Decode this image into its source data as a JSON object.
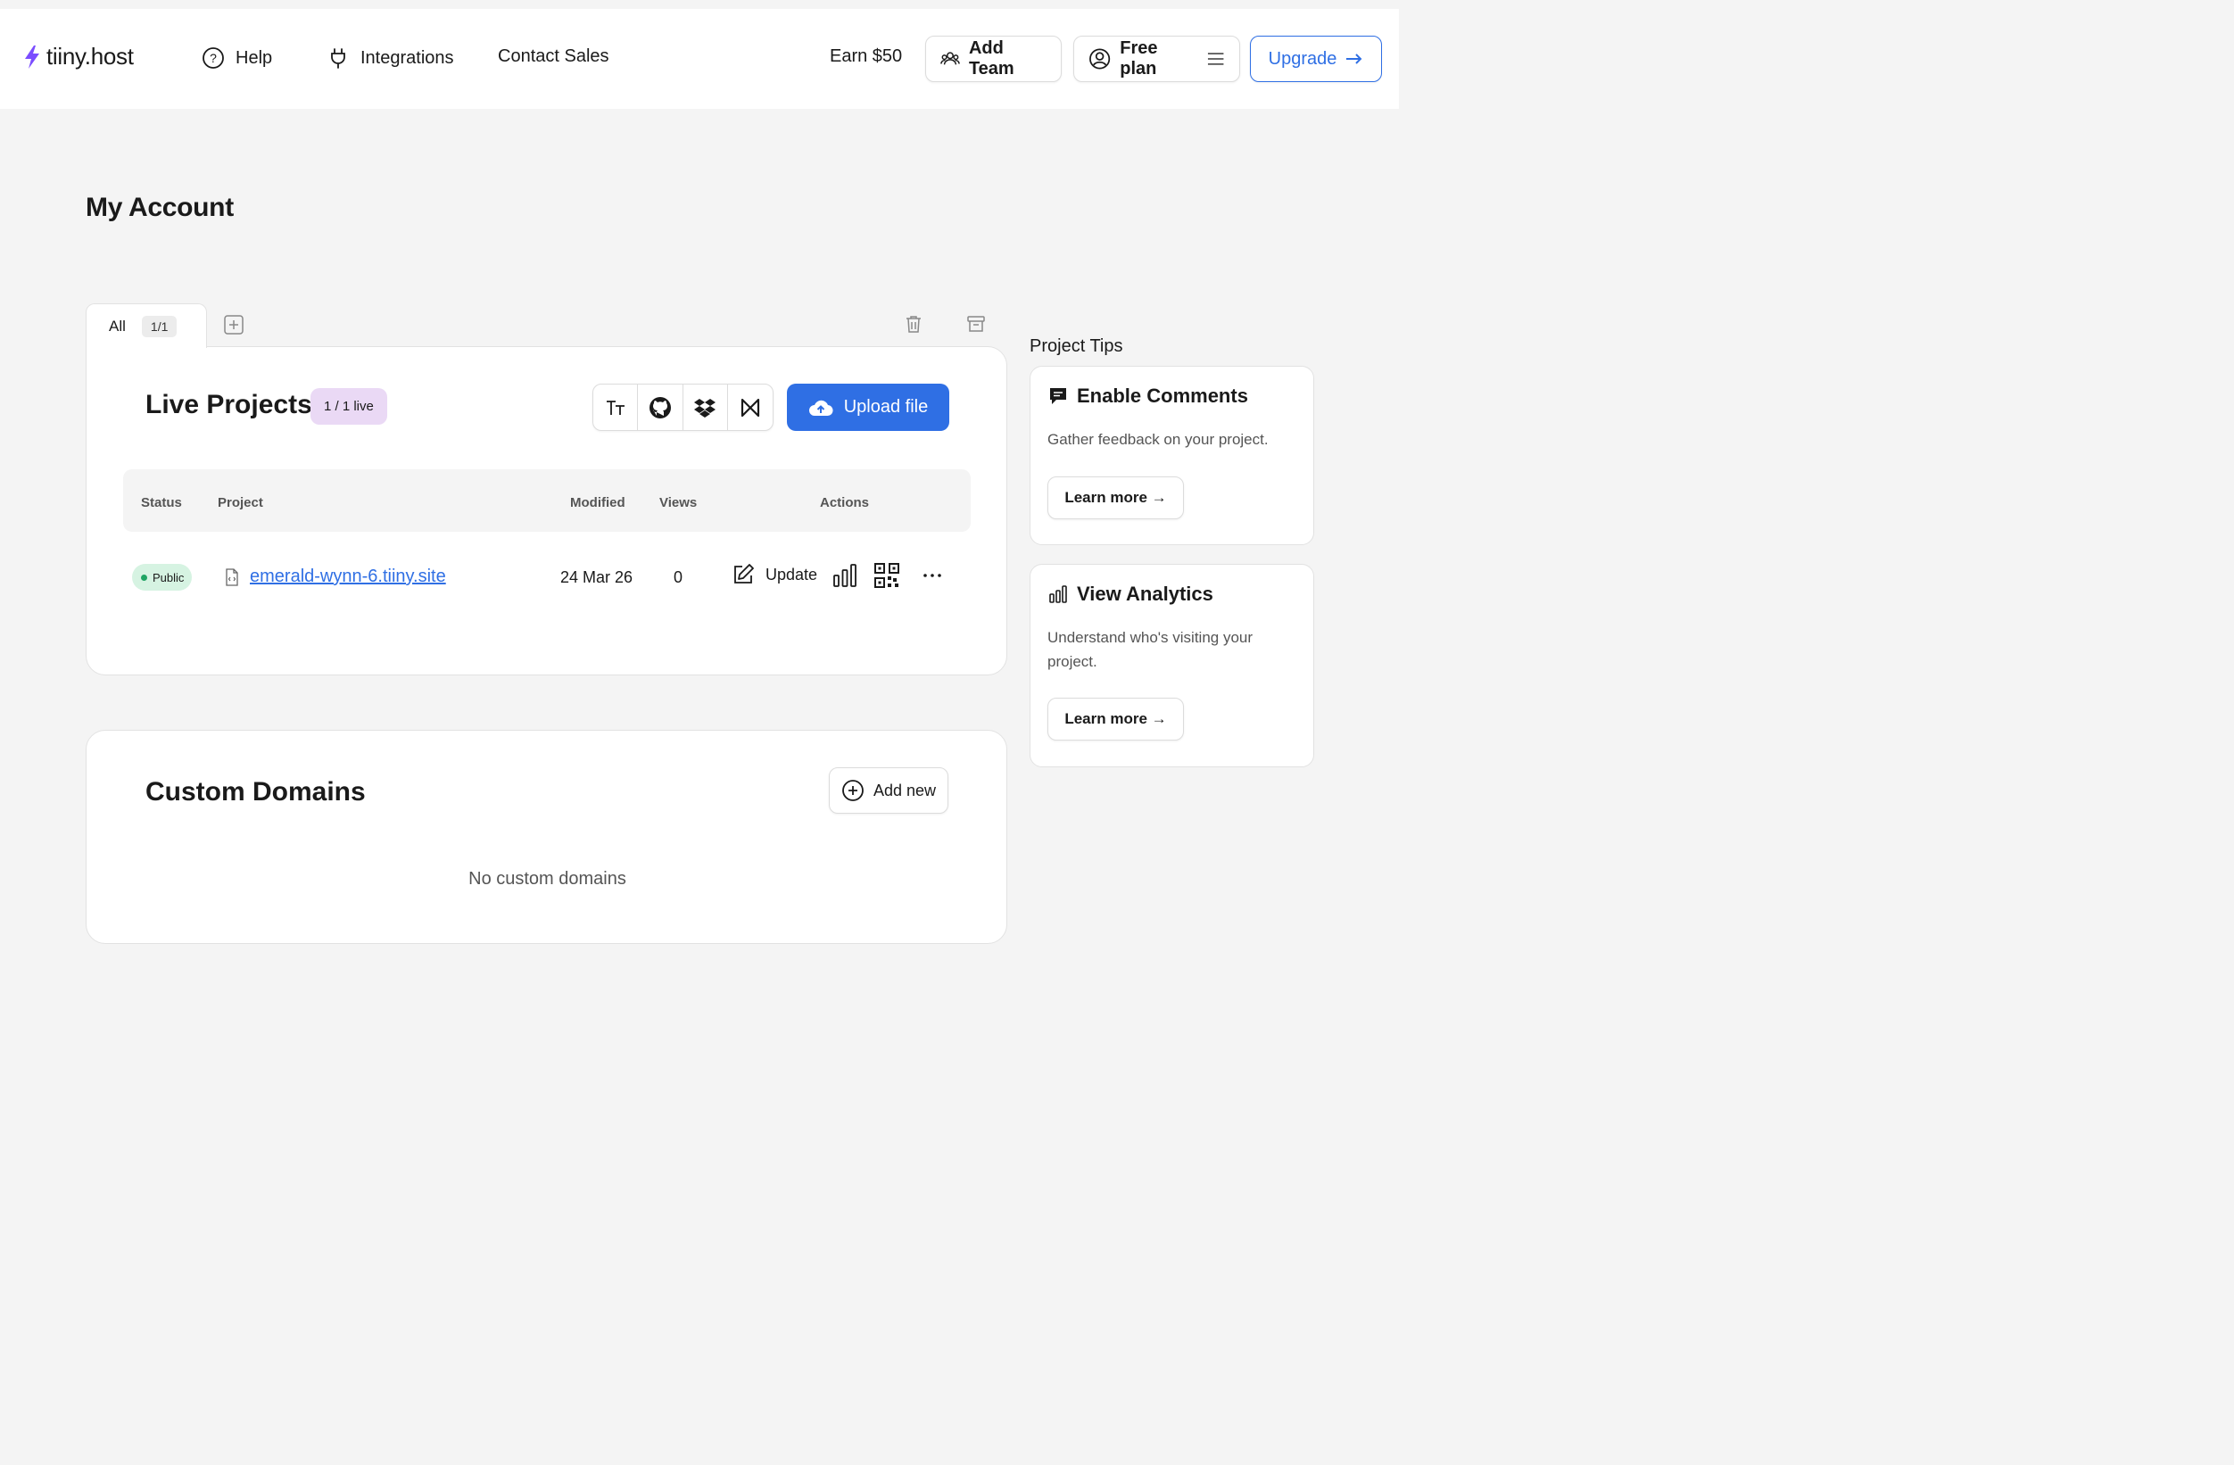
{
  "header": {
    "logo_text": "tiiny.host",
    "nav": {
      "help": "Help",
      "integrations": "Integrations",
      "contact_sales": "Contact Sales"
    },
    "earn": "Earn $50",
    "add_team": "Add Team",
    "free_plan": "Free plan",
    "upgrade": "Upgrade"
  },
  "page_title": "My Account",
  "tabs": {
    "all_label": "All",
    "all_count": "1/1"
  },
  "live_projects": {
    "title": "Live Projects",
    "badge": "1 / 1 live",
    "upload_label": "Upload file",
    "columns": {
      "status": "Status",
      "project": "Project",
      "modified": "Modified",
      "views": "Views",
      "actions": "Actions"
    },
    "rows": [
      {
        "status": "Public",
        "project": "emerald-wynn-6.tiiny.site",
        "modified": "24 Mar 26",
        "views": "0",
        "update_label": "Update"
      }
    ]
  },
  "custom_domains": {
    "title": "Custom Domains",
    "add_new": "Add new",
    "empty": "No custom domains"
  },
  "tips": {
    "label": "Project Tips",
    "items": [
      {
        "title": "Enable Comments",
        "desc": "Gather feedback on your project.",
        "button": "Learn more →"
      },
      {
        "title": "View Analytics",
        "desc": "Understand who's visiting your project.",
        "button": "Learn more →"
      }
    ]
  },
  "colors": {
    "accent": "#2f6fe4",
    "logo": "#7b4dff",
    "public_bg": "#d6f3e2",
    "badge_bg": "#ead9f5"
  }
}
